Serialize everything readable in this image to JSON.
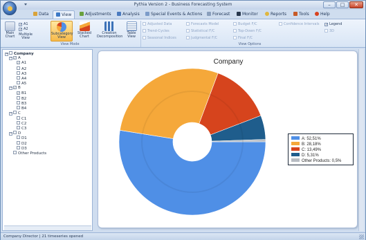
{
  "window": {
    "title": "Pythia Version 2 - Business Forecasting System",
    "minimize": "–",
    "maximize": "□",
    "close": "✕"
  },
  "tabs": [
    {
      "label": "Data",
      "icon": "data-icon",
      "color": "#d9a33a"
    },
    {
      "label": "View",
      "icon": "view-icon",
      "color": "#3d79c6",
      "active": true
    },
    {
      "label": "Adjustments",
      "icon": "adjustments-icon",
      "color": "#6aa13e"
    },
    {
      "label": "Analysis",
      "icon": "analysis-icon",
      "color": "#4b7bbf"
    },
    {
      "label": "Special Events & Actions",
      "icon": "special-events-icon",
      "color": "#7c9cc9"
    },
    {
      "label": "Forecast",
      "icon": "forecast-icon",
      "color": "#8a9fbd"
    },
    {
      "label": "Monitor",
      "icon": "monitor-icon",
      "color": "#28384e"
    },
    {
      "label": "Reports",
      "icon": "reports-icon",
      "color": "#e0b73f"
    },
    {
      "label": "Tools",
      "icon": "tools-icon",
      "color": "#c75b28"
    },
    {
      "label": "Help",
      "icon": "help-icon",
      "color": "#d8421f"
    }
  ],
  "ribbon": {
    "view_mode": {
      "label": "View Mode",
      "buttons": [
        {
          "label": "Main Chart",
          "line1": "Main",
          "line2": "Chart"
        },
        {
          "label": "Multiple View",
          "line1": "Multiple",
          "line2": "View"
        },
        {
          "label": "Subcategory View",
          "line1": "Subcategory",
          "line2": "View",
          "selected": true
        },
        {
          "label": "Stacked Chart",
          "line1": "Stacked",
          "line2": "Chart"
        },
        {
          "label": "Creation Decomposition",
          "line1": "Creation",
          "line2": "Decomposition"
        },
        {
          "label": "Table View",
          "line1": "Table",
          "line2": "View"
        }
      ],
      "a_checks": [
        {
          "label": "A1",
          "checked": "✓"
        },
        {
          "label": "A2",
          "checked": "✓"
        }
      ]
    },
    "view_options": {
      "label": "View Options",
      "col1": [
        "Adjusted Data",
        "Trend-Cycles",
        "Seasonal Indices"
      ],
      "col2": [
        "Forecasts Model",
        "Statistical F/C",
        "Judgmental F/C"
      ],
      "col3": [
        "Budget F/C",
        "Top-Down F/C",
        "Final F/C"
      ],
      "col4": [
        "Confidence Intervals"
      ],
      "legend": {
        "label": "Legend",
        "checked": "✓"
      },
      "three_d": {
        "label": "3D"
      }
    }
  },
  "tree": {
    "root": "Company",
    "groups": [
      {
        "label": "A",
        "children": [
          "A1",
          "A2",
          "A3",
          "A4",
          "A5"
        ],
        "checked": true,
        "child_checked": [
          true,
          false,
          false,
          false,
          false
        ]
      },
      {
        "label": "B",
        "children": [
          "B1",
          "B2",
          "B3",
          "B4"
        ],
        "checked": true,
        "child_checked": [
          true,
          false,
          false,
          false
        ]
      },
      {
        "label": "C",
        "children": [
          "C1",
          "C2",
          "C3"
        ],
        "checked": false,
        "child_checked": [
          false,
          false,
          false
        ]
      },
      {
        "label": "D",
        "children": [
          "D1",
          "D2",
          "D3"
        ],
        "checked": false,
        "child_checked": [
          false,
          false,
          false
        ]
      }
    ],
    "other": "Other Products"
  },
  "chart_data": {
    "type": "pie",
    "title": "Company",
    "slices": [
      {
        "name": "A",
        "value": 52.51,
        "label": "A: 52,51%",
        "color": "#4f8fe6"
      },
      {
        "name": "B",
        "value": 28.18,
        "label": "B: 28,18%",
        "color": "#f5a83a"
      },
      {
        "name": "C",
        "value": 13.49,
        "label": "C: 13,49%",
        "color": "#d6441d"
      },
      {
        "name": "D",
        "value": 5.31,
        "label": "D: 5,31%",
        "color": "#1f5d8c"
      },
      {
        "name": "Other Products",
        "value": 0.5,
        "label": "Other Products: 0,5%",
        "color": "#b8bcc2"
      }
    ],
    "donut": true,
    "legend_position": "right"
  },
  "status": {
    "text": "Company Director | 21 timeseries opened"
  }
}
